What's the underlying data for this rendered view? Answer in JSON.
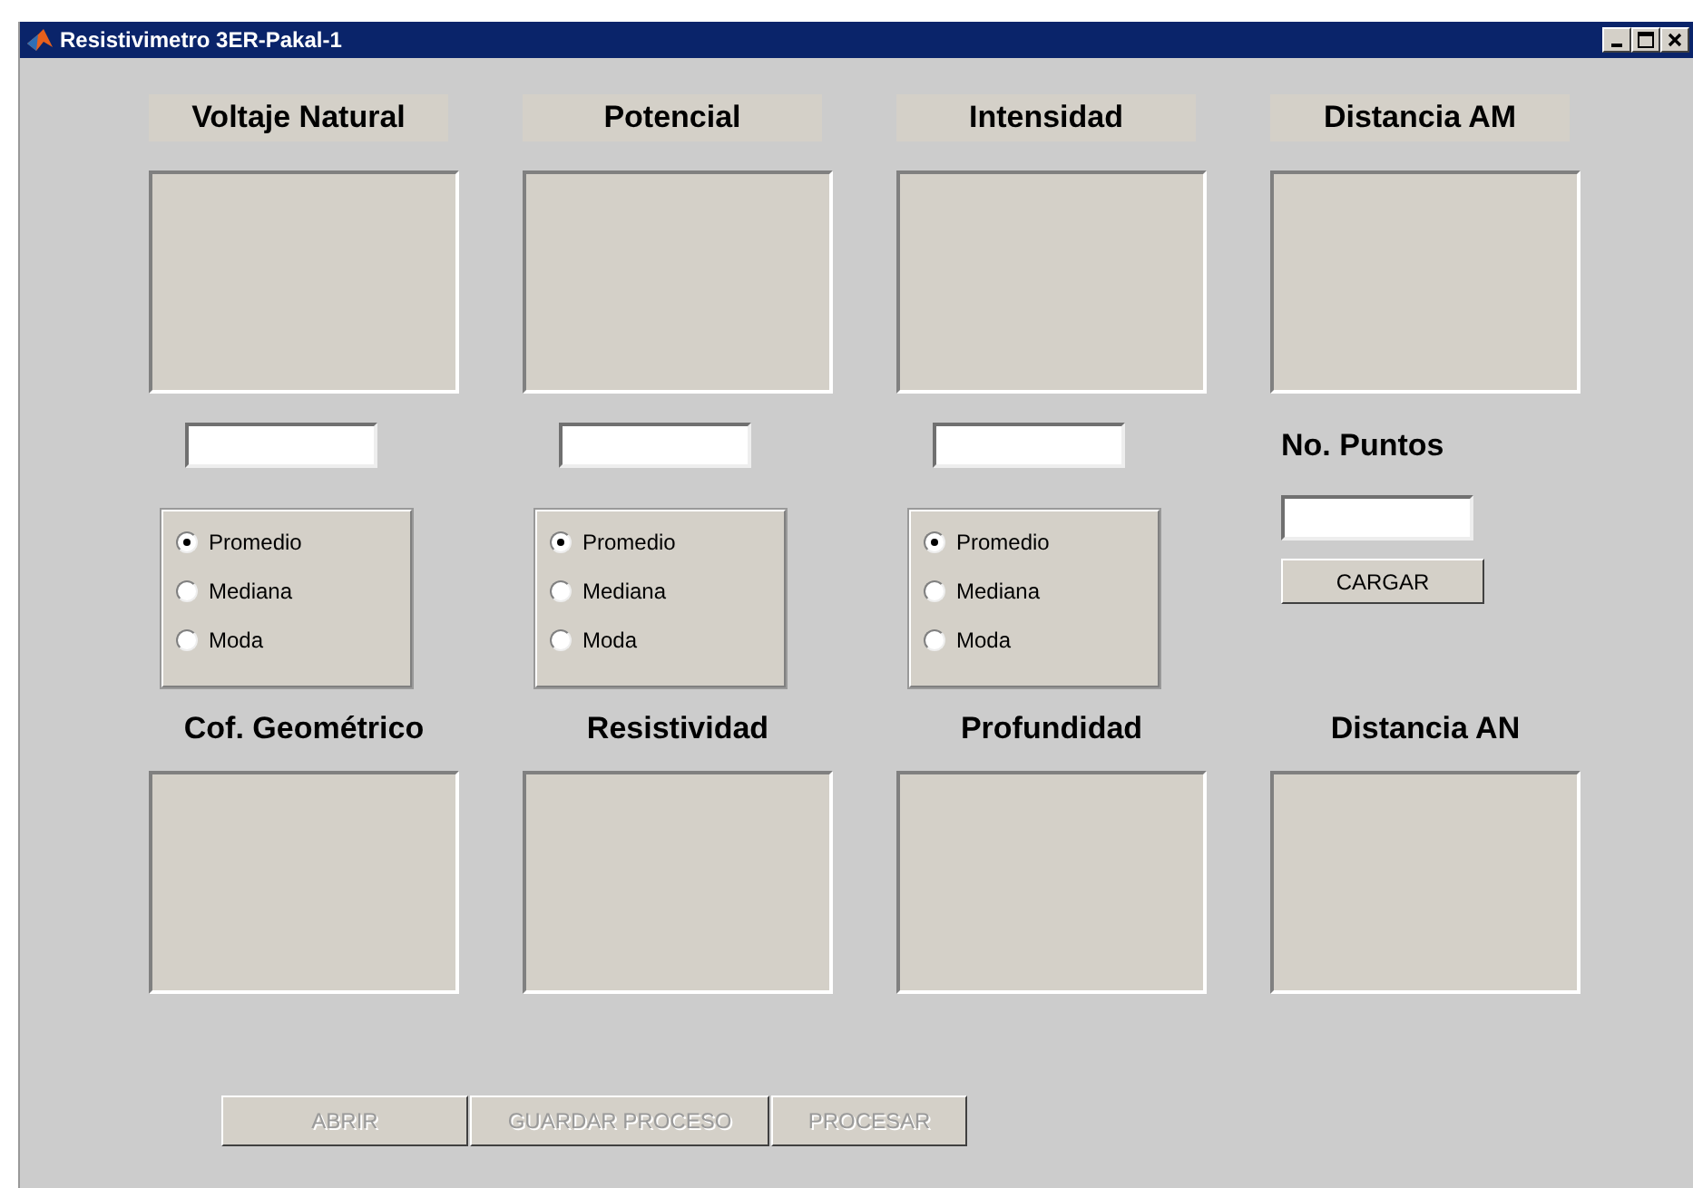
{
  "window": {
    "title": "Resistivimetro 3ER-Pakal-1"
  },
  "top_panels": [
    {
      "label": "Voltaje Natural",
      "options": [
        {
          "label": "Promedio",
          "selected": true
        },
        {
          "label": "Mediana",
          "selected": false
        },
        {
          "label": "Moda",
          "selected": false
        }
      ]
    },
    {
      "label": "Potencial",
      "options": [
        {
          "label": "Promedio",
          "selected": true
        },
        {
          "label": "Mediana",
          "selected": false
        },
        {
          "label": "Moda",
          "selected": false
        }
      ]
    },
    {
      "label": "Intensidad",
      "options": [
        {
          "label": "Promedio",
          "selected": true
        },
        {
          "label": "Mediana",
          "selected": false
        },
        {
          "label": "Moda",
          "selected": false
        }
      ]
    },
    {
      "label": "Distancia AM",
      "points": {
        "label": "No. Puntos",
        "button": "CARGAR"
      }
    }
  ],
  "bottom_panels": [
    {
      "label": "Cof. Geométrico"
    },
    {
      "label": "Resistividad"
    },
    {
      "label": "Profundidad"
    },
    {
      "label": "Distancia AN"
    }
  ],
  "buttons": [
    {
      "label": "ABRIR",
      "disabled": true
    },
    {
      "label": "GUARDAR PROCESO",
      "disabled": true
    },
    {
      "label": "PROCESAR",
      "disabled": true
    }
  ]
}
